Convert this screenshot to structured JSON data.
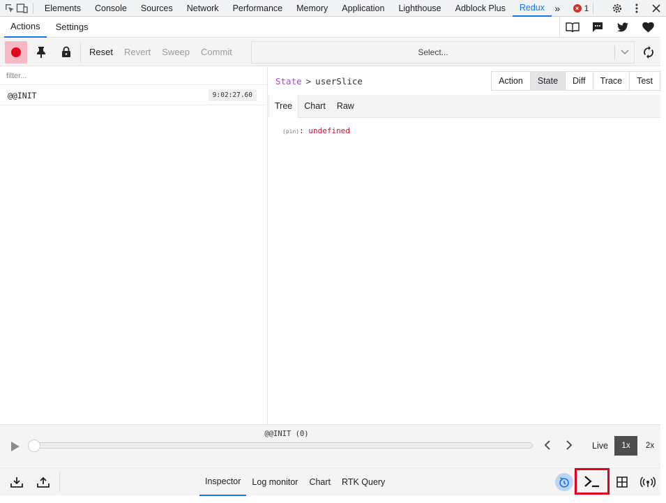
{
  "devtools": {
    "tabs": [
      "Elements",
      "Console",
      "Sources",
      "Network",
      "Performance",
      "Memory",
      "Application",
      "Lighthouse",
      "Adblock Plus",
      "Redux"
    ],
    "active_tab": "Redux",
    "error_count": "1",
    "icons": [
      "inspect-element-icon",
      "device-toolbar-icon",
      "more-tabs-icon",
      "error-icon",
      "settings-icon",
      "more-options-icon",
      "close-icon"
    ]
  },
  "subbar": {
    "tabs": [
      "Actions",
      "Settings"
    ],
    "active_tab": "Actions",
    "icons": [
      "docs-book-icon",
      "feedback-chat-icon",
      "twitter-icon",
      "heart-icon"
    ]
  },
  "toolbar": {
    "reset": "Reset",
    "revert": "Revert",
    "sweep": "Sweep",
    "commit": "Commit",
    "select_placeholder": "Select..."
  },
  "actions_list": {
    "filter_placeholder": "filter...",
    "items": [
      {
        "name": "@@INIT",
        "time": "9:02:27.60"
      }
    ]
  },
  "inspector": {
    "breadcrumb_state": "State",
    "breadcrumb_sep": ">",
    "breadcrumb_slice": "userSlice",
    "modes": [
      "Action",
      "State",
      "Diff",
      "Trace",
      "Test"
    ],
    "active_mode": "State",
    "views": [
      "Tree",
      "Chart",
      "Raw"
    ],
    "active_view": "Tree",
    "tree_key": "(pin)",
    "tree_sep": ": ",
    "tree_value": "undefined"
  },
  "slider": {
    "label": "@@INIT (0)",
    "position": 0,
    "live_label": "Live",
    "speeds": [
      "1x",
      "2x"
    ],
    "active_speed": "1x"
  },
  "bottom": {
    "monitors": [
      "Inspector",
      "Log monitor",
      "Chart",
      "RTK Query"
    ],
    "active_monitor": "Inspector"
  },
  "colors": {
    "accent": "#1a73e8",
    "record": "#e3001b",
    "highlight_box": "#e0001b",
    "state_crumb": "#a14fc5",
    "undefined_value": "#d10f2c"
  }
}
